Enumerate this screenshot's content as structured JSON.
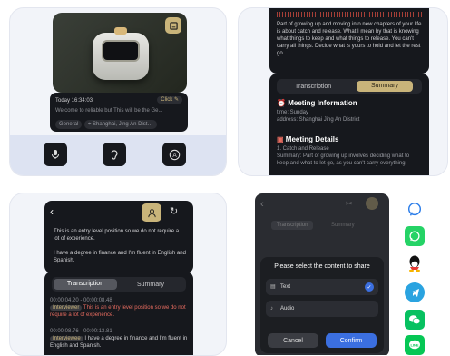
{
  "colors": {
    "accent": "#c9b47a",
    "dark_bg": "#16181d",
    "card_bg": "#f2f4f9",
    "interviewer": "#e56b5f",
    "confirm": "#3b6fe0",
    "waveform": "#c0463c"
  },
  "panel1": {
    "meta": {
      "time": "Today 16:34:03",
      "edit_label": "Click",
      "preview": "Welcome to reliable but This will be the Ge..."
    },
    "chips": {
      "category": "General",
      "location": "Shanghai, Jing An District"
    },
    "toolbar": [
      "microphone-icon",
      "ear-icon",
      "translate-icon"
    ]
  },
  "panel2": {
    "transcript": "Part of growing up and moving into new chapters of your life is about catch and release. What I mean by that is knowing what things to keep and what things to release. You can't carry all things. Decide what is yours to hold and let the rest go.",
    "tabs": [
      "Transcription",
      "Summary"
    ],
    "meeting_info": {
      "heading": "Meeting Information",
      "time": "time: Sunday",
      "address": "address: Shanghai Jing An District"
    },
    "meeting_details": {
      "heading": "Meeting Details",
      "item": "1. Catch and Release",
      "summary": "Summary: Part of growing up involves deciding what to keep and what to let go, as you can't carry everything."
    }
  },
  "panel3": {
    "back": "back-icon",
    "transcript": "This is an entry level position so we do not require a lot of experience.",
    "reply": "I have a degree in finance and I'm fluent in English and Spanish.",
    "tabs": [
      "Transcription",
      "Summary"
    ],
    "entries": [
      {
        "time": "00:00:04.20 - 00:00:08.48",
        "speaker": "Interviewer",
        "text": "This is an entry level position so we do not require a lot of experience."
      },
      {
        "time": "00:00:08.76 - 00:00:13.81",
        "speaker": "Interviewee",
        "text": "I have a degree in finance and I'm fluent in English and Spanish."
      }
    ]
  },
  "panel4": {
    "tabs": [
      "Transcription",
      "Summary"
    ],
    "dialog": {
      "title": "Please select the content to share",
      "options": [
        {
          "label": "Text",
          "checked": true
        },
        {
          "label": "Audio",
          "checked": false
        }
      ],
      "cancel": "Cancel",
      "confirm": "Confirm"
    }
  },
  "share_icons": [
    "messenger-icon",
    "whatsapp-icon",
    "qq-icon",
    "telegram-icon",
    "wechat-icon",
    "line-icon"
  ]
}
